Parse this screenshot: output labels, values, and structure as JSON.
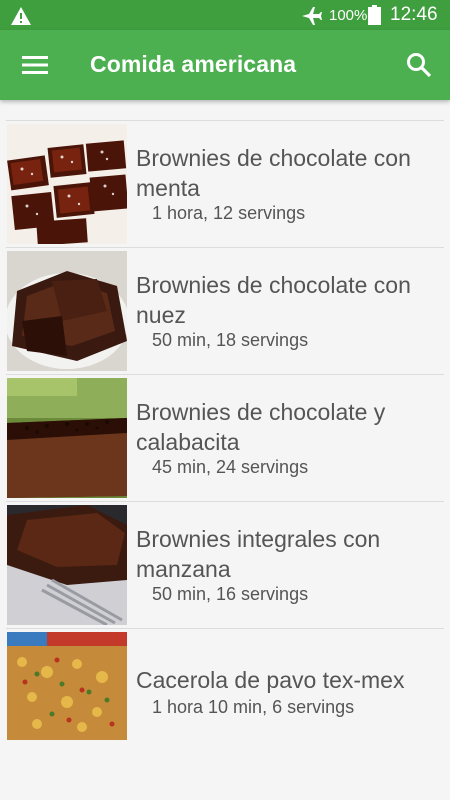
{
  "status_bar": {
    "battery": "100%",
    "time": "12:46",
    "icons": [
      "warning-icon",
      "airplane-mode-icon",
      "battery-icon"
    ]
  },
  "app_bar": {
    "title": "Comida americana",
    "icons": [
      "menu-icon",
      "search-icon"
    ]
  },
  "recipes": [
    {
      "title": "Brownies de chocolate con menta",
      "meta": "1 hora, 12 servings"
    },
    {
      "title": "Brownies de chocolate con nuez",
      "meta": "50 min, 18 servings"
    },
    {
      "title": "Brownies de chocolate y calabacita",
      "meta": "45 min, 24 servings"
    },
    {
      "title": "Brownies integrales con manzana",
      "meta": "50 min, 16 servings"
    },
    {
      "title": "Cacerola de pavo tex-mex",
      "meta": "1 hora 10 min, 6 servings"
    }
  ],
  "colors": {
    "status_bar": "#3f9f3f",
    "app_bar": "#4caf50",
    "background": "#f5f5f5"
  }
}
